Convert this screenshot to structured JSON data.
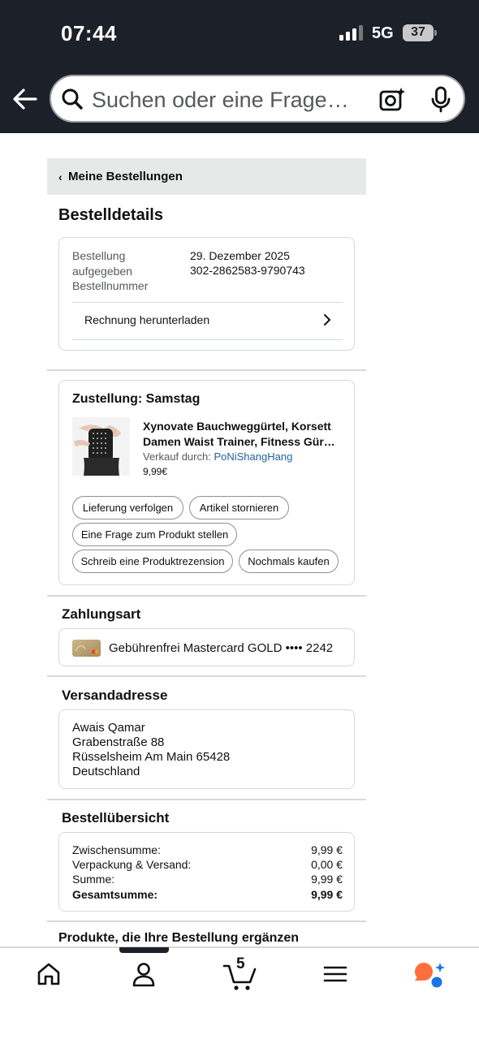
{
  "status_bar": {
    "time": "07:44",
    "network": "5G",
    "battery": "37"
  },
  "search": {
    "placeholder": "Suchen oder eine Frage…"
  },
  "breadcrumb": {
    "label": "Meine Bestellungen"
  },
  "page_title": "Bestelldetails",
  "order_info": {
    "placed_label": "Bestellung aufgegeben",
    "placed_label_line1": "Bestellung",
    "placed_label_line2": "aufgegeben",
    "date": "29. Dezember 2025",
    "number_label": "Bestellnummer",
    "number": "302-2862583-9790743",
    "invoice_link": "Rechnung herunterladen"
  },
  "delivery": {
    "title": "Zustellung: Samstag",
    "product_title_line1": "Xynovate Bauchweggürtel, Korsett",
    "product_title_line2": "Damen Waist Trainer, Fitness Gür…",
    "seller_label": "Verkauf durch:",
    "seller_name": "PoNiShangHang",
    "price": "9,99€",
    "actions": [
      "Lieferung verfolgen",
      "Artikel stornieren",
      "Eine Frage zum Produkt stellen",
      "Schreib eine Produktrezension",
      "Nochmals kaufen"
    ]
  },
  "payment": {
    "title": "Zahlungsart",
    "card": "Gebührenfrei Mastercard GOLD •••• 2242"
  },
  "shipping": {
    "title": "Versandadresse",
    "lines": [
      "Awais Qamar",
      "Grabenstraße 88",
      "Rüsselsheim Am Main 65428",
      "Deutschland"
    ]
  },
  "summary": {
    "title": "Bestellübersicht",
    "rows": [
      {
        "label": "Zwischensumme:",
        "value": "9,99 €"
      },
      {
        "label": "Verpackung & Versand:",
        "value": "0,00 €"
      },
      {
        "label": "Summe:",
        "value": "9,99 €"
      },
      {
        "label": "Gesamtsumme:",
        "value": "9,99 €"
      }
    ]
  },
  "recommendations_title": "Produkte, die Ihre Bestellung ergänzen",
  "tabbar": {
    "cart_count": "5",
    "icons": [
      "home-icon",
      "account-icon",
      "cart-icon",
      "menu-icon",
      "rufus-icon"
    ]
  },
  "colors": {
    "header_bg": "#1c2029",
    "link": "#2162a1",
    "accent_orange": "#ff6f3c",
    "accent_blue": "#1a73e8"
  }
}
